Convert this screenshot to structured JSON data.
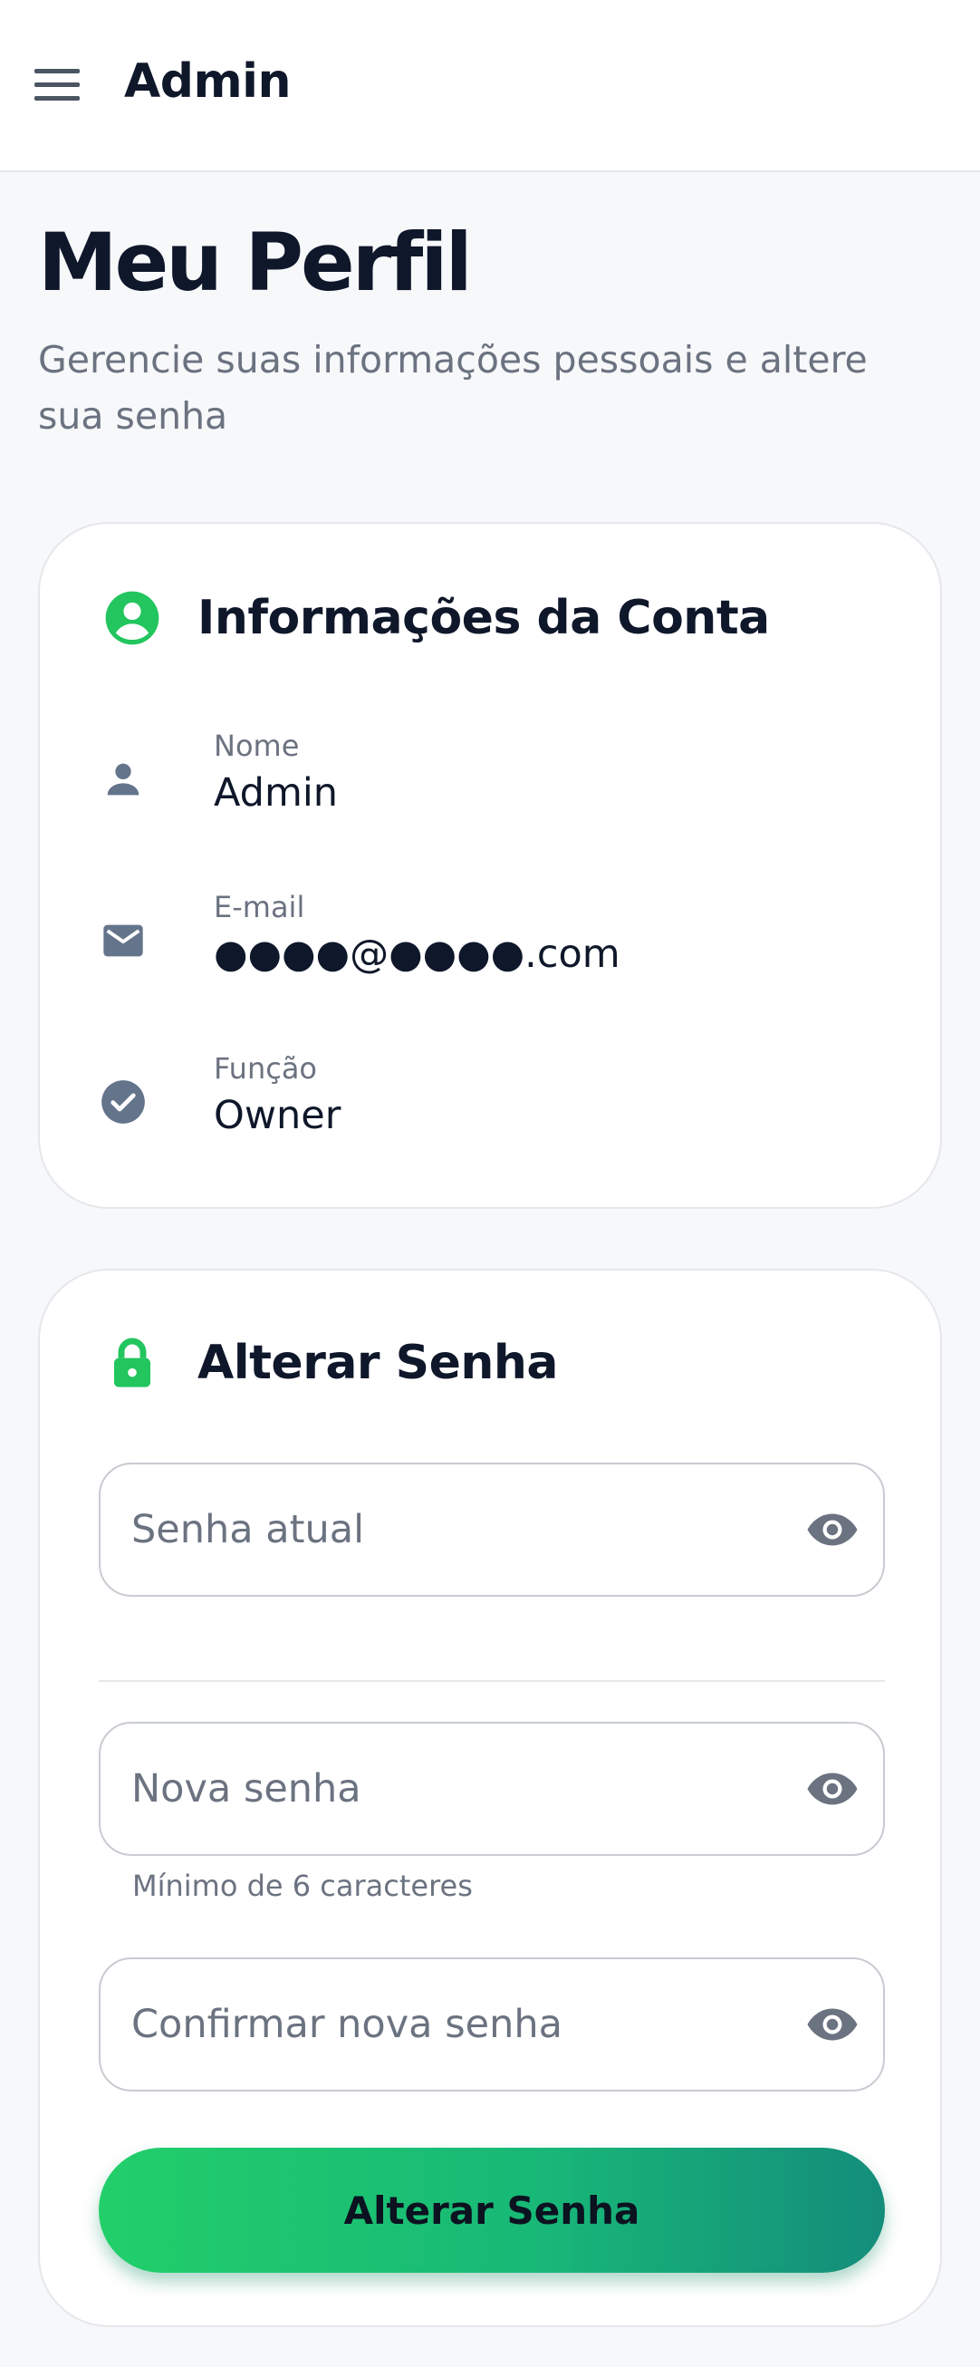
{
  "appbar": {
    "title": "Admin",
    "menu_icon": "menu-icon"
  },
  "page": {
    "title": "Meu Perfil",
    "subtitle": "Gerencie suas informações pessoais e altere sua senha"
  },
  "account": {
    "title": "Informações da Conta",
    "icon": "account-circle-icon",
    "fields": [
      {
        "label": "Nome",
        "value": "Admin",
        "icon": "person-icon"
      },
      {
        "label": "E-mail",
        "value": "●●●●@●●●●.com",
        "icon": "mail-icon"
      },
      {
        "label": "Função",
        "value": "Owner",
        "icon": "check-circle-icon"
      }
    ]
  },
  "password": {
    "title": "Alterar Senha",
    "icon": "lock-icon",
    "current_placeholder": "Senha atual",
    "new_placeholder": "Nova senha",
    "new_helper": "Mínimo de 6 caracteres",
    "confirm_placeholder": "Confirmar nova senha",
    "submit_label": "Alterar Senha",
    "eye_icon": "eye-icon"
  },
  "colors": {
    "accent": "#22c55e",
    "accent_end": "#148d7b",
    "text_primary": "#0f172a",
    "text_secondary": "#6b7280",
    "icon_gray": "#64748b"
  }
}
